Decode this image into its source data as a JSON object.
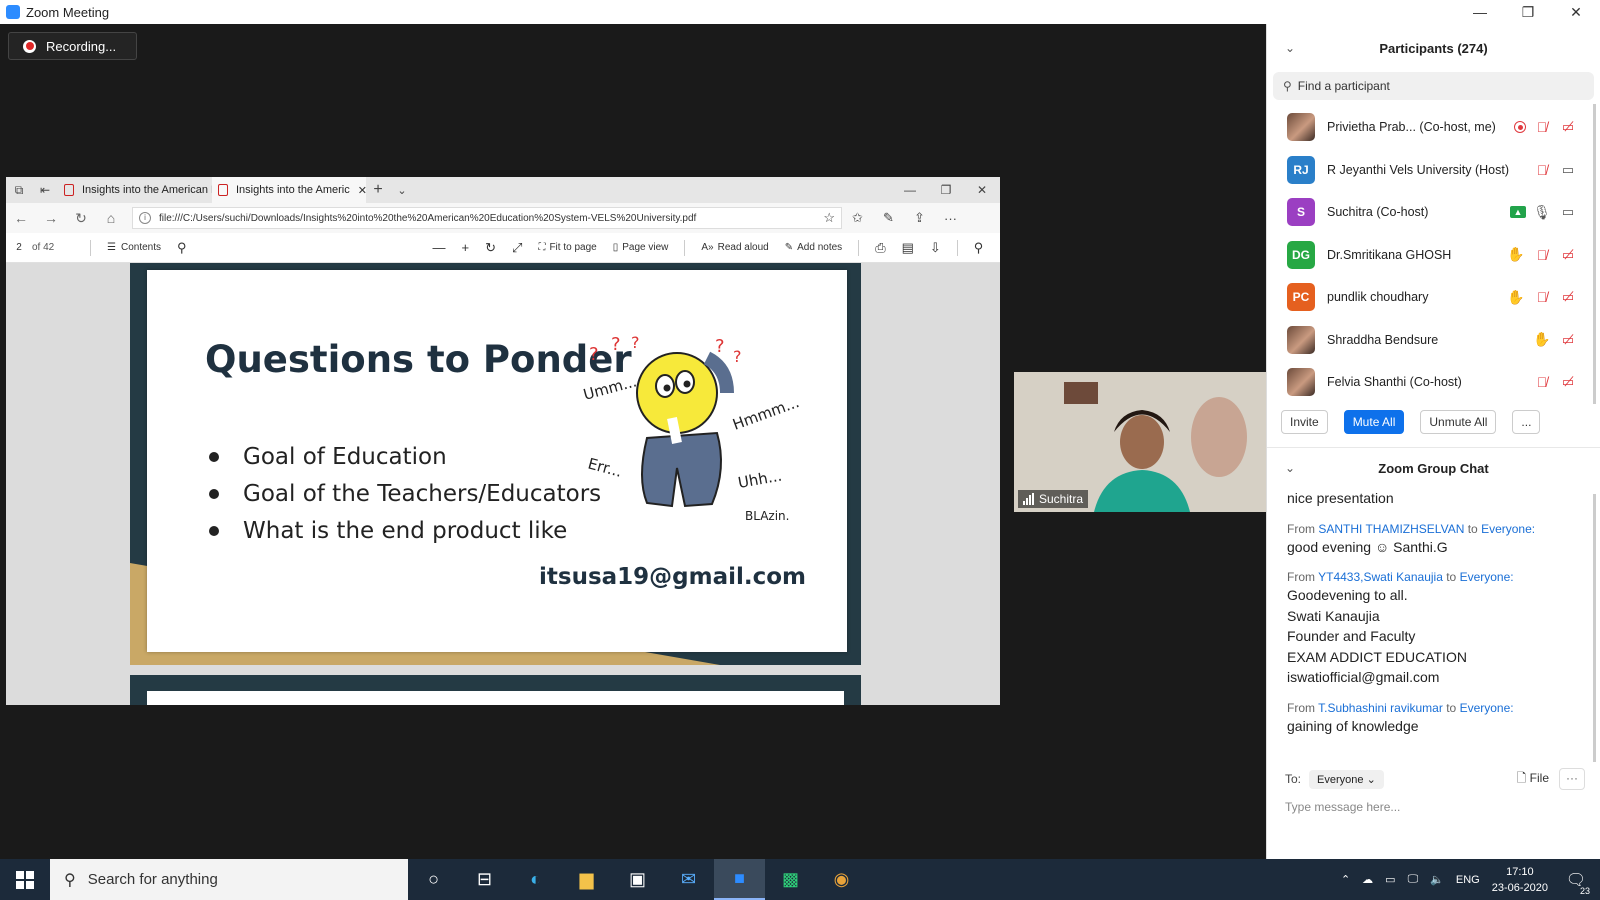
{
  "window": {
    "title": "Zoom Meeting",
    "minimize": "—",
    "restore": "❐",
    "close": "✕"
  },
  "recording": {
    "label": "Recording..."
  },
  "browser": {
    "tabs": [
      {
        "title": "Insights into the American E"
      },
      {
        "title": "Insights into the Americ"
      }
    ],
    "url": "file:///C:/Users/suchi/Downloads/Insights%20into%20the%20American%20Education%20System-VELS%20University.pdf",
    "pdf_toolbar": {
      "page": "2",
      "of": "of 42",
      "contents": "Contents",
      "fit_to_page": "Fit to page",
      "page_view": "Page view",
      "read_aloud": "Read aloud",
      "add_notes": "Add notes"
    }
  },
  "slide": {
    "title": "Questions to Ponder",
    "bullets": [
      "Goal of Education",
      "Goal of the Teachers/Educators",
      "What is the end product like"
    ],
    "email": "itsusa19@gmail.com",
    "cartoon_words": [
      "Umm...",
      "Hmmm...",
      "Err...",
      "Uhh...",
      "BLAzin."
    ]
  },
  "video": {
    "name": "Suchitra"
  },
  "participants": {
    "header": "Participants (274)",
    "search_placeholder": "Find a participant",
    "list": [
      {
        "initials": "",
        "name": "Privietha Prab...  (Co-host, me)"
      },
      {
        "initials": "RJ",
        "name": "R Jeyanthi Vels University (Host)",
        "color": "#2a7fc9"
      },
      {
        "initials": "S",
        "name": "Suchitra (Co-host)",
        "color": "#9b3fc2"
      },
      {
        "initials": "DG",
        "name": "Dr.Smritikana GHOSH",
        "color": "#27a844"
      },
      {
        "initials": "PC",
        "name": "pundlik choudhary",
        "color": "#e5601f"
      },
      {
        "initials": "",
        "name": "Shraddha Bendsure"
      },
      {
        "initials": "",
        "name": "Felvia Shanthi (Co-host)"
      }
    ],
    "buttons": {
      "invite": "Invite",
      "mute_all": "Mute All",
      "unmute_all": "Unmute All",
      "more": "..."
    }
  },
  "chat": {
    "header": "Zoom Group Chat",
    "messages": [
      {
        "from": "",
        "to": "",
        "lines": [
          "nice presentation"
        ]
      },
      {
        "from": "SANTHI THAMIZHSELVAN",
        "to": "Everyone:",
        "lines": [
          "good evening ☺ Santhi.G"
        ]
      },
      {
        "from": "YT4433,Swati Kanaujia",
        "to": "Everyone:",
        "lines": [
          "Goodevening to all.",
          "Swati Kanaujia",
          "Founder and Faculty",
          "EXAM ADDICT EDUCATION",
          "iswatiofficial@gmail.com"
        ]
      },
      {
        "from": "T.Subhashini ravikumar",
        "to": "Everyone:",
        "lines": [
          "gaining of knowledge"
        ]
      }
    ],
    "from_word": "From",
    "to_word": "to",
    "to_label": "To:",
    "recipient": "Everyone",
    "file": "File",
    "more": "···",
    "placeholder": "Type message here..."
  },
  "taskbar": {
    "search": "Search for anything",
    "lang": "ENG",
    "time": "17:10",
    "date": "23-06-2020",
    "notif_count": "23"
  }
}
